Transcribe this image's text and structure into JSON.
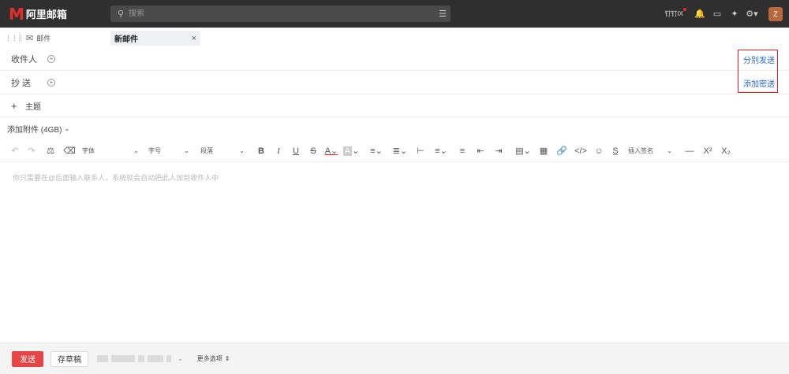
{
  "header": {
    "logo_mark": "M",
    "logo_text": "阿里邮箱",
    "search_placeholder": "搜索",
    "right_text": "钉钉IX",
    "avatar_letter": "Z"
  },
  "tabs": {
    "mail_label": "邮件",
    "new_mail_label": "新邮件",
    "close_glyph": "×"
  },
  "compose": {
    "to_label": "收件人",
    "cc_label": "抄 送",
    "subject_label": "主题",
    "separate_send_link": "分别发送",
    "add_bcc_link": "添加密送",
    "attachment_label": "添加附件 (4GB)",
    "editor_placeholder": "你只需要在@后面输入联系人，系统就会自动把此人加到收件人中"
  },
  "toolbar": {
    "font_family": "字体",
    "font_size": "字号",
    "paragraph": "段落",
    "insert": "插入签名"
  },
  "bottom": {
    "send_label": "发送",
    "draft_label": "存草稿",
    "more_options": "更多选项"
  },
  "colors": {
    "topbar": "#2f2f2f",
    "accent_red": "#e54545",
    "link_blue": "#2a6ac9",
    "highlight_border": "#e02020"
  }
}
